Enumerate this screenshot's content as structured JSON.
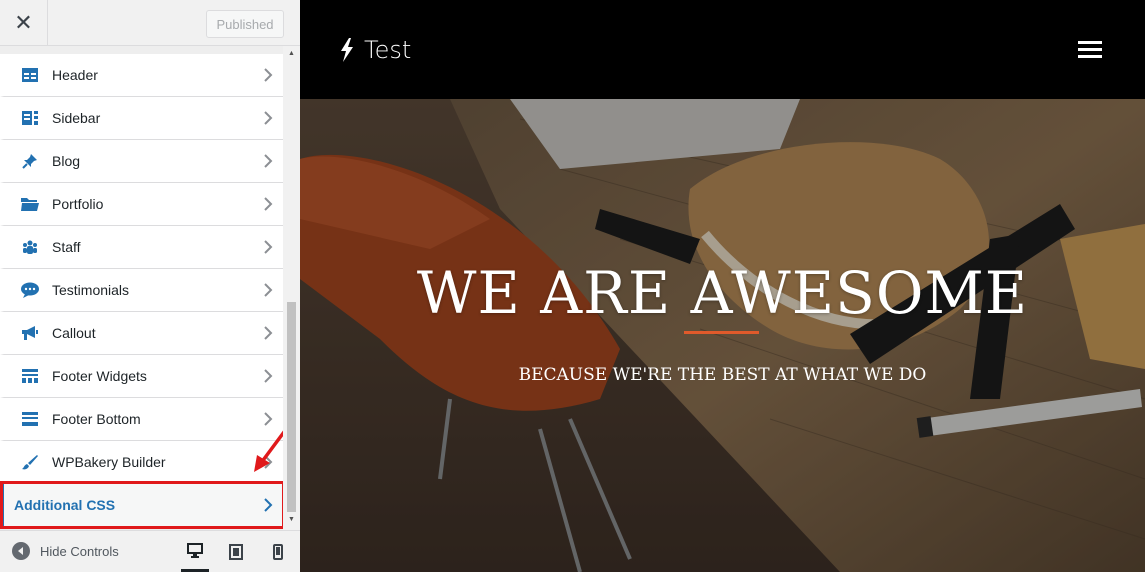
{
  "customizer": {
    "close_label": "✕",
    "publish_label": "Published",
    "menu": [
      {
        "label": "Header",
        "icon": "header-layout-icon"
      },
      {
        "label": "Sidebar",
        "icon": "sidebar-layout-icon"
      },
      {
        "label": "Blog",
        "icon": "pin-icon"
      },
      {
        "label": "Portfolio",
        "icon": "folder-icon"
      },
      {
        "label": "Staff",
        "icon": "people-icon"
      },
      {
        "label": "Testimonials",
        "icon": "speech-bubble-icon"
      },
      {
        "label": "Callout",
        "icon": "megaphone-icon"
      },
      {
        "label": "Footer Widgets",
        "icon": "footer-widgets-icon"
      },
      {
        "label": "Footer Bottom",
        "icon": "footer-bottom-icon"
      },
      {
        "label": "WPBakery Builder",
        "icon": "brush-icon"
      },
      {
        "label": "Additional CSS",
        "active": true
      }
    ],
    "footer": {
      "hide_controls_label": "Hide Controls",
      "devices": [
        "desktop",
        "tablet",
        "mobile"
      ],
      "active_device": "desktop"
    }
  },
  "site": {
    "title": "Test",
    "hero": {
      "heading": "WE ARE AWESOME",
      "subheading": "BECAUSE WE'RE THE BEST AT WHAT WE DO"
    }
  },
  "colors": {
    "accent_blue": "#2271b1",
    "annotation_red": "#e0191b",
    "hero_rule": "#e05a2b"
  }
}
